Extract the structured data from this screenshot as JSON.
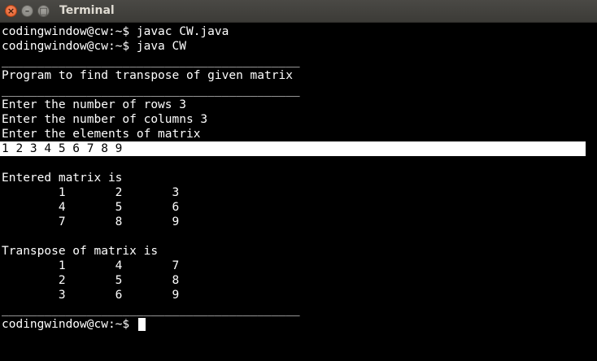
{
  "window": {
    "title": "Terminal",
    "close_glyph": "×",
    "minimize_glyph": "–",
    "maximize_glyph": "□"
  },
  "terminal": {
    "lines": [
      "codingwindow@cw:~$ javac CW.java",
      "codingwindow@cw:~$ java CW",
      "__________________________________________",
      "Program to find transpose of given matrix",
      "__________________________________________",
      "Enter the number of rows 3",
      "Enter the number of columns 3",
      "Enter the elements of matrix",
      "1 2 3 4 5 6 7 8 9",
      "",
      "Entered matrix is",
      "        1       2       3",
      "        4       5       6",
      "        7       8       9",
      "",
      "Transpose of matrix is",
      "        1       4       7",
      "        2       5       8",
      "        3       6       9",
      "__________________________________________",
      "codingwindow@cw:~$ "
    ]
  },
  "colors": {
    "background": "#000000",
    "foreground": "#ffffff",
    "titlebar": "#3c3b37",
    "close_button": "#e25a24"
  }
}
